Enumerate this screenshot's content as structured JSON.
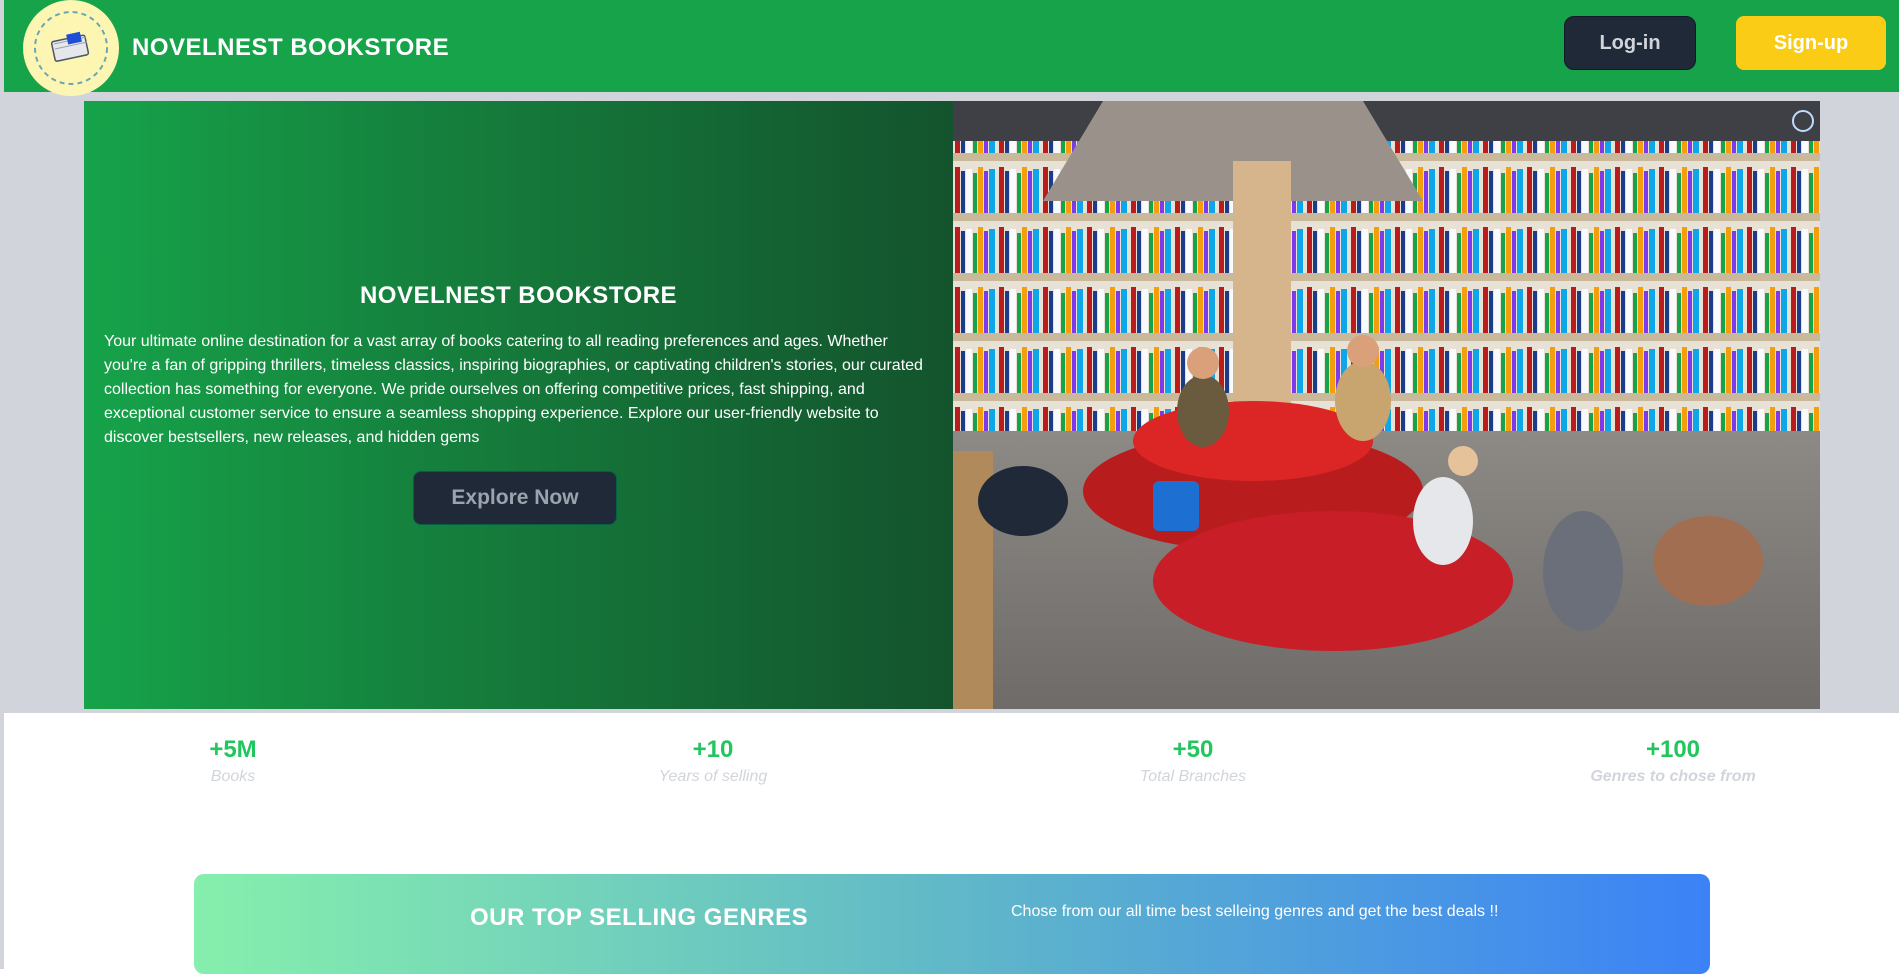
{
  "navbar": {
    "brand": "NOVELNEST BOOKSTORE",
    "login_label": "Log-in",
    "signup_label": "Sign-up"
  },
  "hero": {
    "title": "NOVELNEST BOOKSTORE",
    "description": "Your ultimate online destination for a vast array of books catering to all reading preferences and ages. Whether you're a fan of gripping thrillers, timeless classics, inspiring biographies, or captivating children's stories, our curated collection has something for everyone. We pride ourselves on offering competitive prices, fast shipping, and exceptional customer service to ensure a seamless shopping experience. Explore our user-friendly website to discover bestsellers, new releases, and hidden gems",
    "cta_label": "Explore Now"
  },
  "stats": [
    {
      "value": "+5M",
      "label": "Books"
    },
    {
      "value": "+10",
      "label": "Years of selling"
    },
    {
      "value": "+50",
      "label": "Total Branches"
    },
    {
      "value": "+100",
      "label": "Genres to chose from"
    }
  ],
  "genres": {
    "title": "OUR TOP SELLING GENRES",
    "subtitle": "Chose from our all time best selleing genres and get the best deals !!"
  },
  "colors": {
    "navbar": "#16a34a",
    "accent_green": "#22c55e",
    "dark_button": "#1f2937",
    "signup_yellow": "#facc15",
    "banner_start": "#86efac",
    "banner_end": "#3b82f6"
  },
  "icons": {
    "logo": "book-logo-icon",
    "image_action": "screenshot-icon"
  }
}
